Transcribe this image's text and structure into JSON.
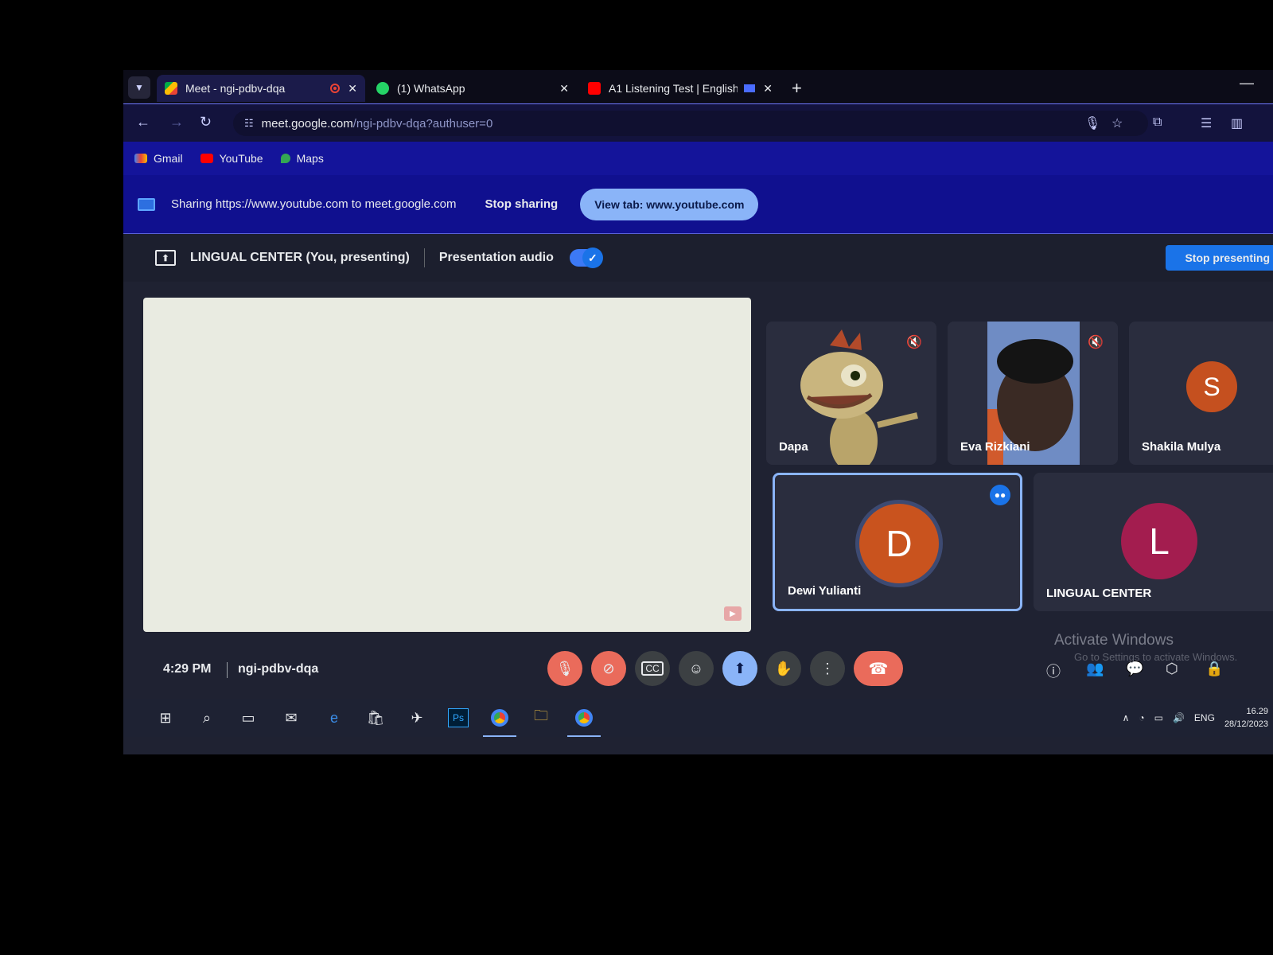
{
  "browser": {
    "tabs": [
      {
        "title": "Meet - ngi-pdbv-dqa",
        "active": true
      },
      {
        "title": "(1) WhatsApp",
        "active": false
      },
      {
        "title": "A1 Listening Test | English",
        "active": false
      }
    ],
    "url_host": "meet.google.com",
    "url_path": "/ngi-pdbv-dqa?authuser=0",
    "bookmarks": [
      "Gmail",
      "YouTube",
      "Maps"
    ]
  },
  "share_bar": {
    "text": "Sharing https://www.youtube.com to meet.google.com",
    "stop_label": "Stop sharing",
    "view_tab_label": "View tab: www.youtube.com"
  },
  "meet": {
    "presenter_label": "LINGUAL CENTER (You, presenting)",
    "presentation_audio_label": "Presentation audio",
    "presentation_audio_on": true,
    "stop_presenting_label": "Stop presenting",
    "participants": [
      {
        "name": "Dapa",
        "muted": true
      },
      {
        "name": "Eva Rizkiani",
        "muted": true
      },
      {
        "name": "Shakila Mulya",
        "initial": "S",
        "color": "#c5501f"
      },
      {
        "name": "Dewi Yulianti",
        "initial": "D",
        "color": "#c9531e",
        "speaking": true
      },
      {
        "name": "LINGUAL CENTER",
        "initial": "L",
        "color": "#a31d4f"
      }
    ],
    "time": "4:29 PM",
    "meeting_code": "ngi-pdbv-dqa"
  },
  "windows": {
    "watermark_title": "Activate Windows",
    "watermark_sub": "Go to Settings to activate Windows.",
    "tray_lang": "ENG",
    "tray_time": "16.29",
    "tray_date": "28/12/2023"
  },
  "colors": {
    "accent": "#1a73e8",
    "end_call": "#ea6b5b",
    "sharebar_bg": "#10108f"
  }
}
